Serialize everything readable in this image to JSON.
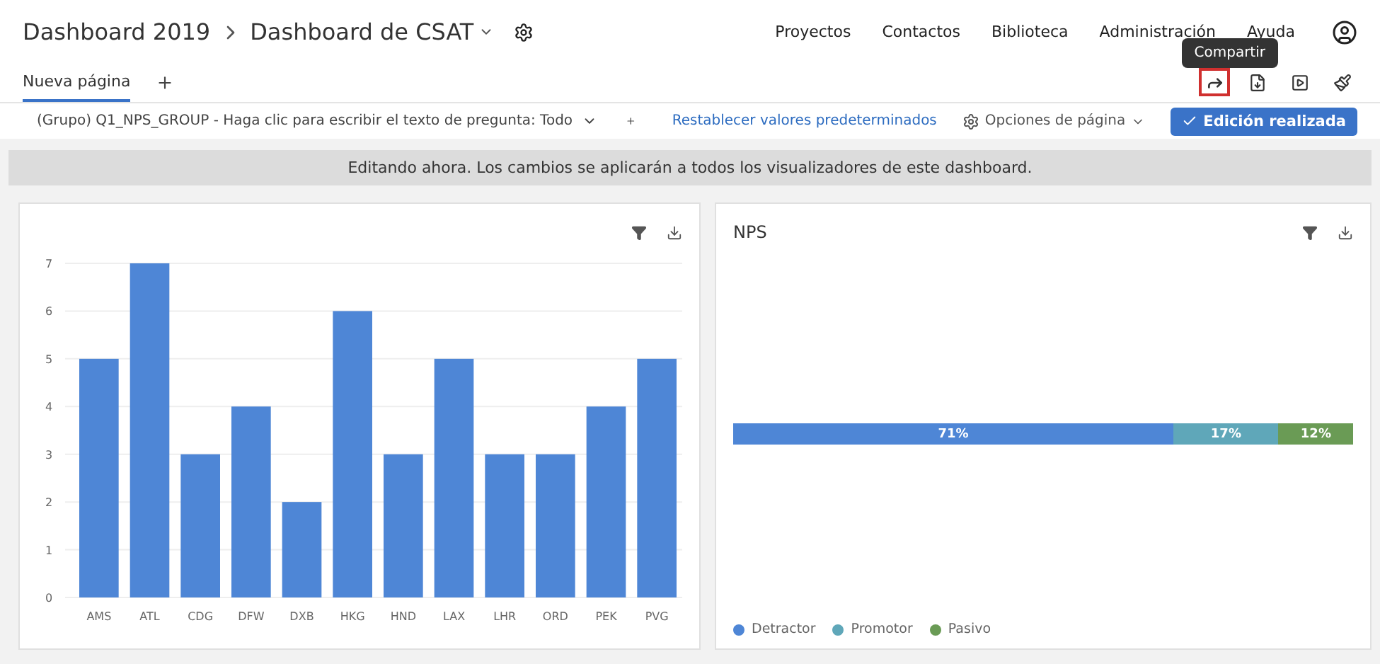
{
  "header": {
    "breadcrumb": [
      "Dashboard 2019",
      "Dashboard de CSAT"
    ],
    "nav": [
      "Proyectos",
      "Contactos",
      "Biblioteca",
      "Administración",
      "Ayuda"
    ]
  },
  "tabs": [
    {
      "label": "Nueva página",
      "selected": true
    }
  ],
  "tooltip": "Compartir",
  "filter_bar": {
    "filter": "(Grupo) Q1_NPS_GROUP - Haga clic para escribir el texto de pregunta: Todo",
    "reset_link": "Restablecer valores predeterminados",
    "options": "Opciones de página",
    "done_button": "Edición realizada"
  },
  "banner": "Editando ahora. Los cambios se aplicarán a todos los visualizadores de este dashboard.",
  "widgets": [
    {
      "kind": "columns",
      "chart_data": {
        "type": "bar",
        "categories": [
          "AMS",
          "ATL",
          "CDG",
          "DFW",
          "DXB",
          "HKG",
          "HND",
          "LAX",
          "LHR",
          "ORD",
          "PEK",
          "PVG"
        ],
        "values": [
          5,
          7,
          3,
          4,
          2,
          6,
          3,
          5,
          3,
          3,
          4,
          5
        ],
        "ylim": [
          0,
          7
        ],
        "yticks": [
          0,
          1,
          2,
          3,
          4,
          5,
          6,
          7
        ],
        "grid": true
      }
    },
    {
      "kind": "stacked",
      "title": "NPS",
      "chart_data": {
        "type": "bar",
        "orientation": "horizontal",
        "stacked": true,
        "series": [
          {
            "name": "Detractor",
            "color": "#4e86d6",
            "values": [
              71
            ],
            "value_labels": [
              "71%"
            ]
          },
          {
            "name": "Promotor",
            "color": "#5fa7b9",
            "values": [
              17
            ],
            "value_labels": [
              "17%"
            ]
          },
          {
            "name": "Pasivo",
            "color": "#6a9b55",
            "values": [
              12
            ],
            "value_labels": [
              "12%"
            ]
          }
        ]
      }
    }
  ]
}
